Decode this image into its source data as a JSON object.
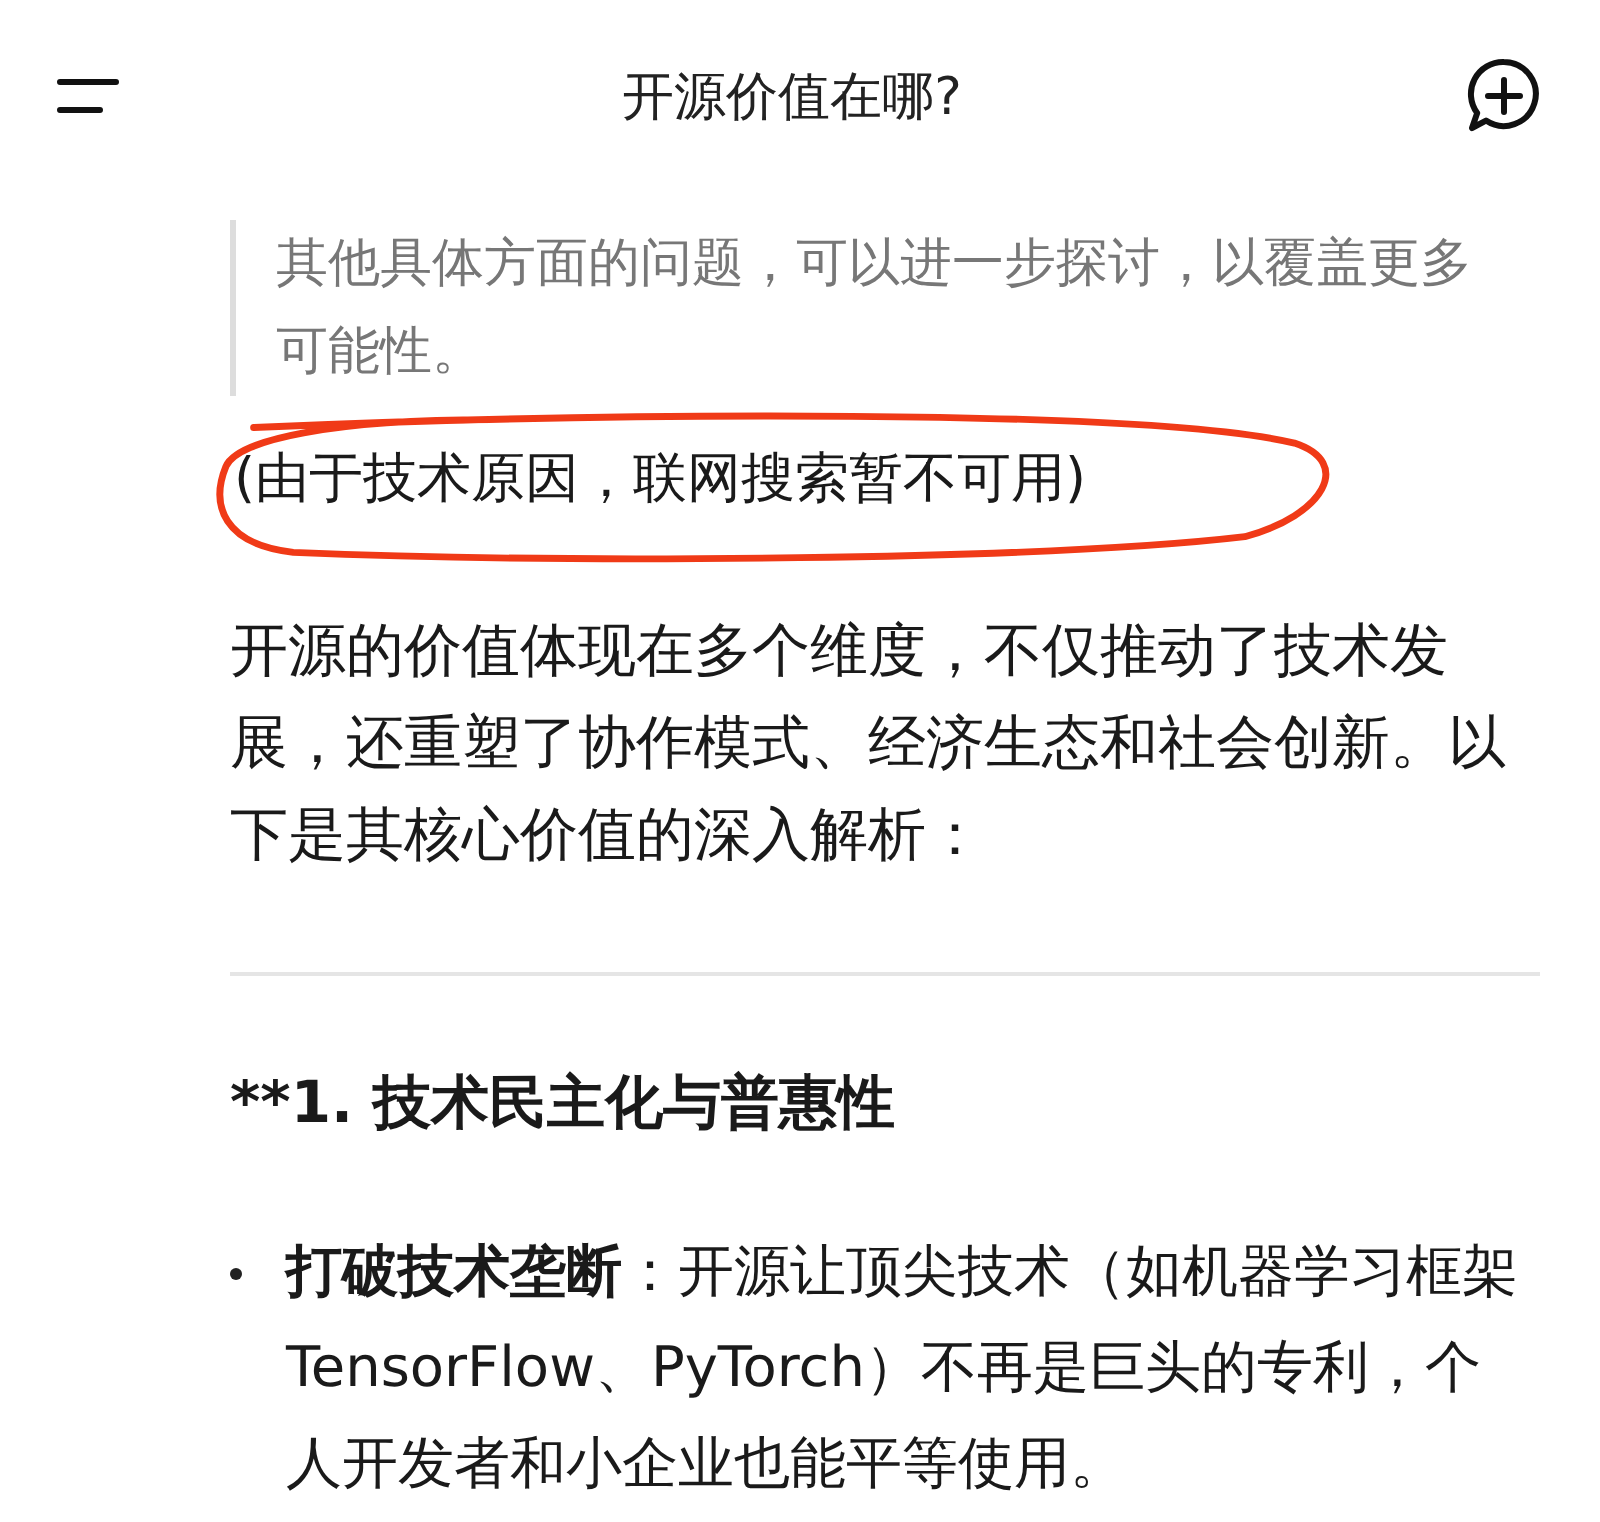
{
  "header": {
    "title": "开源价值在哪?"
  },
  "quote": "其他具体方面的问题，可以进一步探讨，以覆盖更多可能性。",
  "note": {
    "text": "(由于技术原因，联网搜索暂不可用)",
    "circled": true
  },
  "paragraph": "开源的价值体现在多个维度，不仅推动了技术发展，还重塑了协作模式、经济生态和社会创新。以下是其核心价值的深入解析：",
  "heading": "**1. 技术民主化与普惠性",
  "bullets": [
    {
      "text": "**打破技术垄断**：开源让顶尖技术（如机器学习框架 TensorFlow、PyTorch）不再是巨头的专利，个人开发者和小企业也能平等使用。"
    }
  ]
}
